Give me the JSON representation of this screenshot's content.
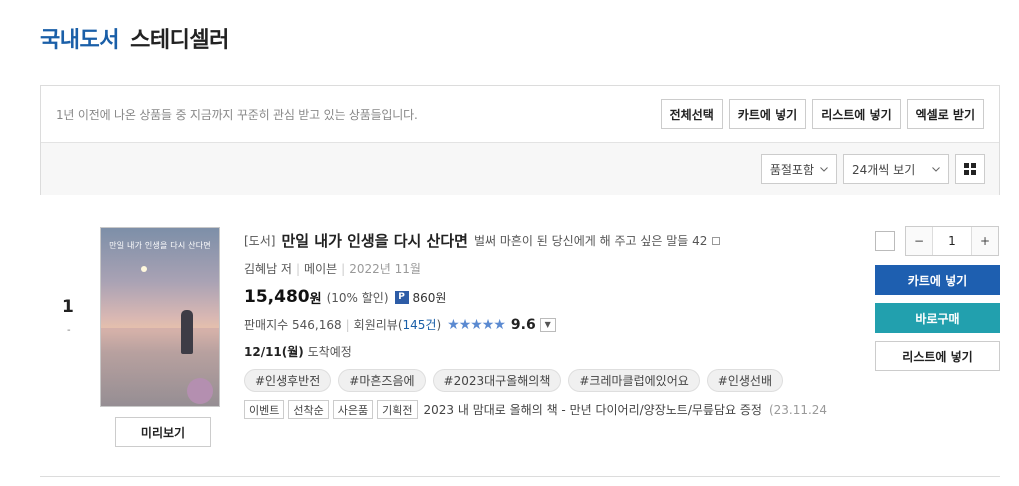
{
  "header": {
    "category": "국내도서",
    "title": "스테디셀러"
  },
  "info": {
    "description": "1년 이전에 나온 상품들 중 지금까지 꾸준히 관심 받고 있는 상품들입니다.",
    "buttons": {
      "select_all": "전체선택",
      "add_cart": "카트에 넣기",
      "add_list": "리스트에 넣기",
      "excel": "엑셀로 받기"
    },
    "filters": {
      "stock": "품절포함",
      "per_page": "24개씩 보기"
    }
  },
  "item": {
    "rank": "1",
    "rank_change": "-",
    "cover_title": "만일 내가 인생을 다시 산다면",
    "preview_label": "미리보기",
    "type": "[도서]",
    "title": "만일 내가 인생을 다시 산다면",
    "subtitle": "벌써 마흔이 된 당신에게 해 주고 싶은 말들 42",
    "author": "김혜남 저",
    "publisher": "메이븐",
    "date": "2022년 11월",
    "price": "15,480",
    "price_unit": "원",
    "discount": "(10% 할인)",
    "point_icon": "P",
    "point": "860원",
    "sales_index": "판매지수 546,168",
    "review_label": "회원리뷰(",
    "review_count": "145건",
    "review_close": ")",
    "stars": "★★★★★",
    "rating": "9.6",
    "delivery_date": "12/11(월)",
    "delivery_text": "도착예정",
    "tags": [
      "#인생후반전",
      "#마흔즈음에",
      "#2023대구올해의책",
      "#크레마클럽에있어요",
      "#인생선배"
    ],
    "event_badges": [
      "이벤트",
      "선착순",
      "사은품",
      "기획전"
    ],
    "event_text": "2023 내 맘대로 올해의 책 - 만년 다이어리/양장노트/무릎담요 증정",
    "event_date": "(23.11.24"
  },
  "actions": {
    "qty_minus": "−",
    "qty_value": "1",
    "qty_plus": "+",
    "cart": "카트에 넣기",
    "buy": "바로구매",
    "list": "리스트에 넣기"
  },
  "colors": {
    "accent_blue": "#1e5fb0",
    "buy_teal": "#22a0ae",
    "star_blue": "#5b8ad1"
  },
  "icons": [
    "chevron-down-icon",
    "grid-view-icon",
    "point-icon",
    "expand-icon"
  ]
}
